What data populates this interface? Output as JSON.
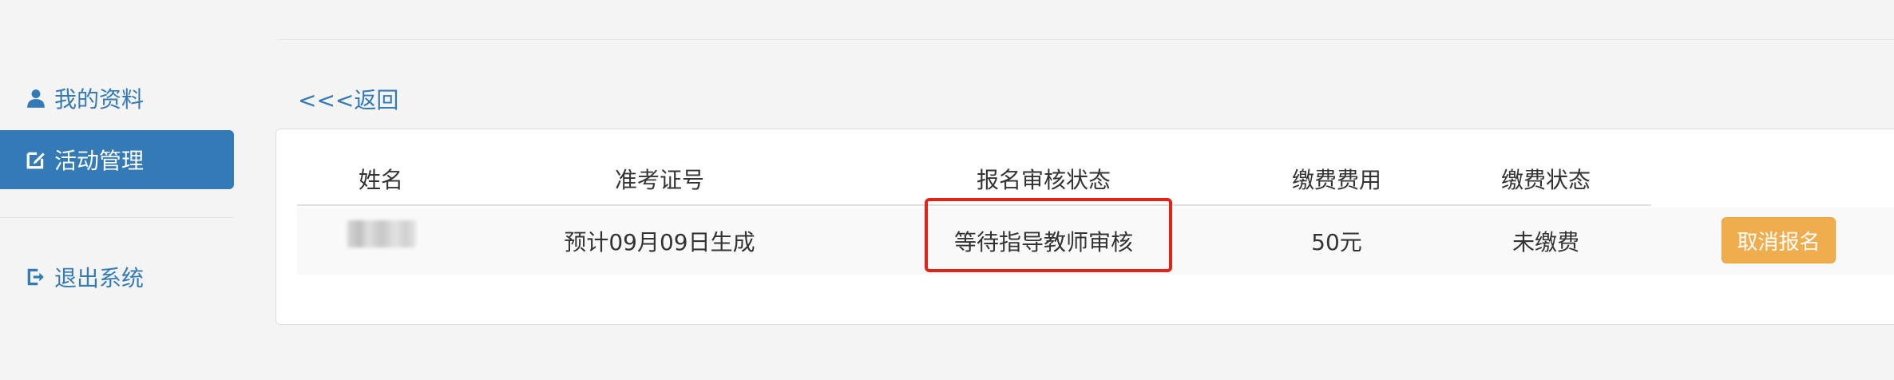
{
  "sidebar": {
    "items": [
      {
        "label": "我的资料",
        "icon": "user-icon"
      },
      {
        "label": "活动管理",
        "icon": "edit-icon"
      },
      {
        "label": "退出系统",
        "icon": "logout-icon"
      }
    ]
  },
  "back_link": "<<<返回",
  "table": {
    "headers": [
      "姓名",
      "准考证号",
      "报名审核状态",
      "缴费费用",
      "缴费状态"
    ],
    "row": {
      "name": "",
      "exam_id": "预计09月09日生成",
      "review_status": "等待指导教师审核",
      "fee": "50元",
      "payment_status": "未缴费",
      "action_label": "取消报名"
    }
  },
  "colors": {
    "primary": "#337ab7",
    "warning": "#f0ad4e",
    "highlight": "#e2231a"
  }
}
